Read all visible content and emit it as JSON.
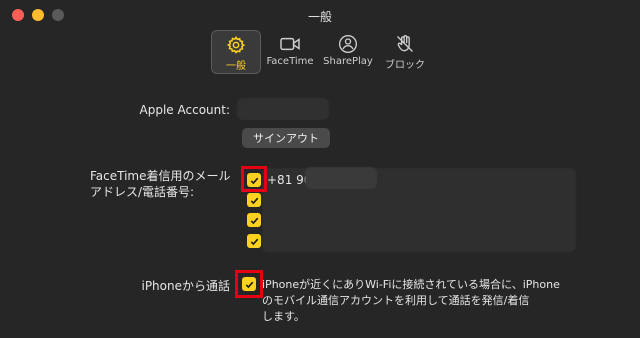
{
  "window": {
    "title": "一般"
  },
  "tabs": [
    {
      "label": "一般"
    },
    {
      "label": "FaceTime"
    },
    {
      "label": "SharePlay"
    },
    {
      "label": "ブロック"
    }
  ],
  "apple_account": {
    "label": "Apple Account:",
    "sign_out": "サインアウト"
  },
  "facetime_addresses": {
    "label": "FaceTime着信用のメール\nアドレス/電話番号:",
    "phone": "+81 90"
  },
  "iphone_calls": {
    "label": "iPhoneから通話",
    "description": "iPhoneが近くにありWi-Fiに接続されている場合に、iPhone\nのモバイル通信アカウントを利用して通話を発信/着信\nします。"
  },
  "colors": {
    "accent": "#ffd21f",
    "highlight": "#e60012"
  }
}
